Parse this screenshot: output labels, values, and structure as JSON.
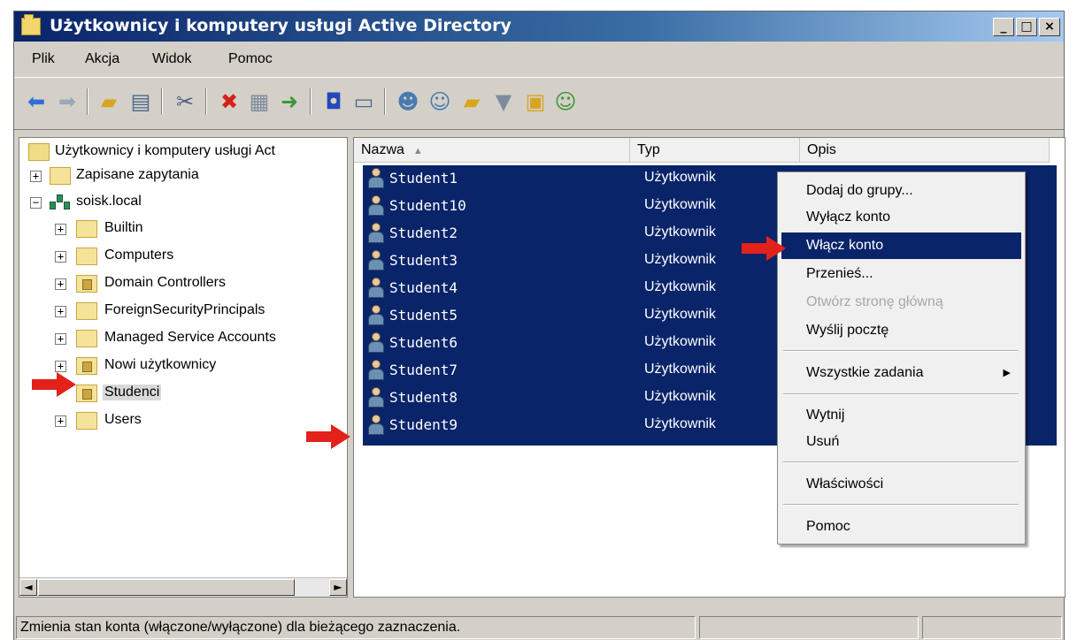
{
  "window": {
    "title": "Użytkownicy i komputery usługi Active Directory",
    "controls": {
      "minimize": "_",
      "maximize": "□",
      "close": "×"
    }
  },
  "menubar": {
    "items": [
      "Plik",
      "Akcja",
      "Widok",
      "Pomoc"
    ]
  },
  "toolbar": {
    "icons": [
      "back-icon",
      "forward-icon",
      "up-folder-icon",
      "console-tree-icon",
      "cut-icon",
      "delete-icon",
      "properties-icon",
      "export-icon",
      "help-icon",
      "view-icon",
      "new-user-icon",
      "new-group-icon",
      "new-ou-icon",
      "filter-icon",
      "find-icon",
      "add-to-group-icon"
    ]
  },
  "tree": {
    "root_label": "Użytkownicy i komputery usługi Act",
    "items": [
      {
        "label": "Zapisane zapytania",
        "expander": "+"
      },
      {
        "label": "soisk.local",
        "expander": "−"
      },
      {
        "label": "Builtin",
        "expander": "+"
      },
      {
        "label": "Computers",
        "expander": "+"
      },
      {
        "label": "Domain Controllers",
        "expander": "+"
      },
      {
        "label": "ForeignSecurityPrincipals",
        "expander": "+"
      },
      {
        "label": "Managed Service Accounts",
        "expander": "+"
      },
      {
        "label": "Nowi użytkownicy",
        "expander": "+"
      },
      {
        "label": "Studenci",
        "expander": ""
      },
      {
        "label": "Users",
        "expander": "+"
      }
    ],
    "scroll_left": "◄",
    "scroll_right": "►"
  },
  "list": {
    "columns": {
      "name": "Nazwa",
      "sort_indicator": "▲",
      "type": "Typ",
      "description": "Opis"
    },
    "rows": [
      {
        "name": "Student1",
        "type": "Użytkownik"
      },
      {
        "name": "Student10",
        "type": "Użytkownik"
      },
      {
        "name": "Student2",
        "type": "Użytkownik"
      },
      {
        "name": "Student3",
        "type": "Użytkownik"
      },
      {
        "name": "Student4",
        "type": "Użytkownik"
      },
      {
        "name": "Student5",
        "type": "Użytkownik"
      },
      {
        "name": "Student6",
        "type": "Użytkownik"
      },
      {
        "name": "Student7",
        "type": "Użytkownik"
      },
      {
        "name": "Student8",
        "type": "Użytkownik"
      },
      {
        "name": "Student9",
        "type": "Użytkownik"
      }
    ]
  },
  "context_menu": {
    "add_to_group": "Dodaj do grupy...",
    "disable_account": "Wyłącz konto",
    "enable_account": "Włącz konto",
    "move": "Przenieś...",
    "open_home_page": "Otwórz stronę główną",
    "send_mail": "Wyślij pocztę",
    "all_tasks": "Wszystkie zadania",
    "submenu_arrow": "▶",
    "cut": "Wytnij",
    "delete": "Usuń",
    "properties": "Właściwości",
    "help": "Pomoc"
  },
  "statusbar": {
    "text": "Zmienia stan konta (włączone/wyłączone) dla bieżącego zaznaczenia."
  },
  "colors": {
    "selection": "#0a246a",
    "arrow": "#e3211b",
    "window_bg": "#d4d0c8"
  }
}
